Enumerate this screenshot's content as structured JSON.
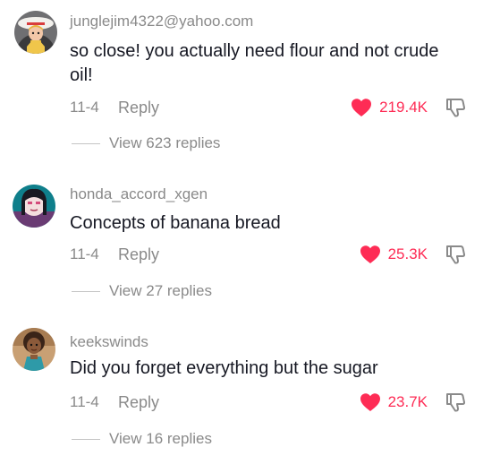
{
  "comments": [
    {
      "username": "junglejim4322@yahoo.com",
      "text": "so close! you actually need flour and not crude oil!",
      "date": "11-4",
      "reply_label": "Reply",
      "likes": "219.4K",
      "view_replies": "View 623 replies"
    },
    {
      "username": "honda_accord_xgen",
      "text": "Concepts of banana bread",
      "date": "11-4",
      "reply_label": "Reply",
      "likes": "25.3K",
      "view_replies": "View 27 replies"
    },
    {
      "username": "keekswinds",
      "text": "Did you forget everything but the sugar",
      "date": "11-4",
      "reply_label": "Reply",
      "likes": "23.7K",
      "view_replies": "View 16 replies"
    }
  ],
  "colors": {
    "like": "#fe2c55",
    "secondary_text": "#8a8a8a",
    "primary_text": "#161823"
  },
  "icons": {
    "like": "heart-icon",
    "dislike": "thumbs-down-icon"
  }
}
